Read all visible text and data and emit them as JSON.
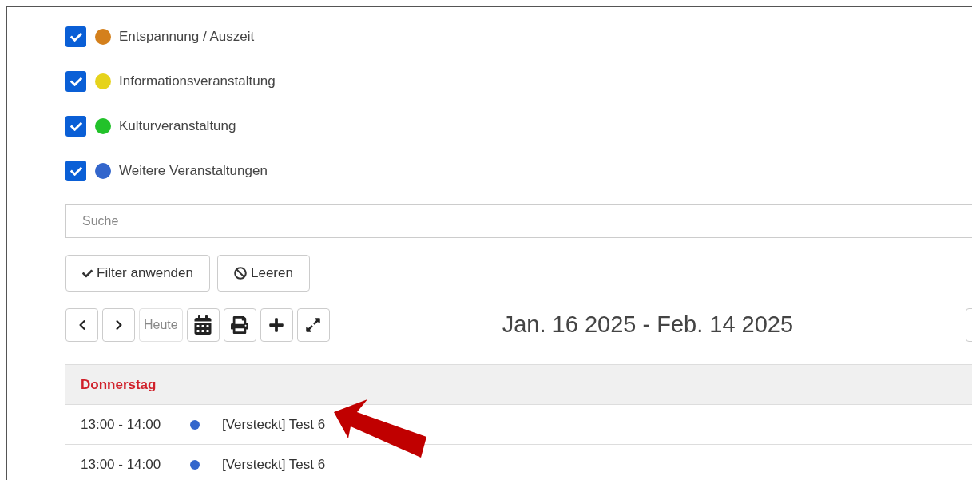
{
  "filters": [
    {
      "label": "Entspannung / Auszeit",
      "checked": true,
      "color": "#d4801c"
    },
    {
      "label": "Informationsveranstaltung",
      "checked": true,
      "color": "#e6d31c"
    },
    {
      "label": "Kulturveranstaltung",
      "checked": true,
      "color": "#22c22a"
    },
    {
      "label": "Weitere Veranstaltungen",
      "checked": true,
      "color": "#3366cc"
    }
  ],
  "search": {
    "placeholder": "Suche"
  },
  "buttons": [
    {
      "kind": "apply",
      "label": "Filter anwenden"
    },
    {
      "kind": "clear",
      "label": "Leeren"
    }
  ],
  "toolbar": [
    {
      "kind": "prev",
      "disabled": false
    },
    {
      "kind": "next",
      "disabled": false
    },
    {
      "kind": "today",
      "label": "Heute",
      "disabled": true
    },
    {
      "kind": "calendar",
      "disabled": false
    },
    {
      "kind": "print",
      "disabled": false
    },
    {
      "kind": "add",
      "disabled": false
    },
    {
      "kind": "expand",
      "disabled": false
    }
  ],
  "date_range": "Jan. 16 2025 - Feb. 14 2025",
  "agenda": {
    "day": "Donnerstag",
    "events": [
      {
        "time": "13:00 - 14:00",
        "color": "#3366cc",
        "title": "[Versteckt] Test 6"
      },
      {
        "time": "13:00 - 14:00",
        "color": "#3366cc",
        "title": "[Versteckt] Test 6"
      }
    ]
  }
}
